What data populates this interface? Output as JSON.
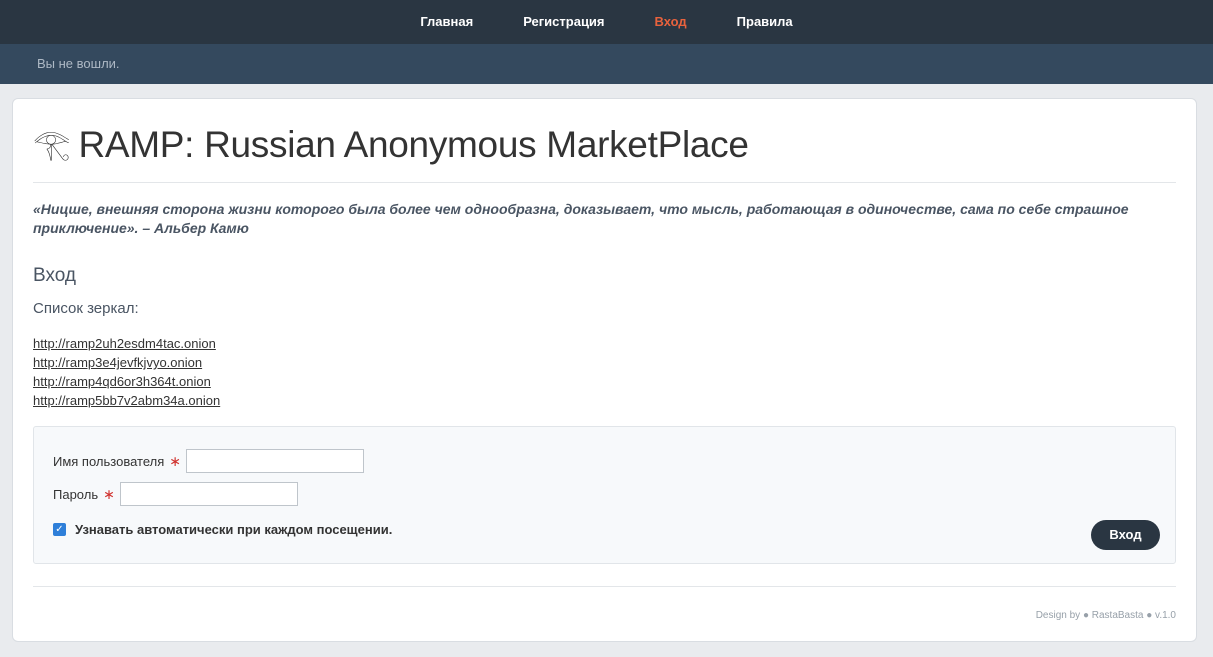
{
  "nav": {
    "items": [
      {
        "label": "Главная"
      },
      {
        "label": "Регистрация"
      },
      {
        "label": "Вход"
      },
      {
        "label": "Правила"
      }
    ]
  },
  "status": {
    "text": "Вы не вошли."
  },
  "header": {
    "title": "RAMP: Russian Anonymous MarketPlace",
    "icon": "eye-of-horus-icon"
  },
  "quote": {
    "text": "«Ницше, внешняя сторона жизни которого была более чем однообразна, доказывает, что мысль, работающая в одиночестве, сама по себе страшное приключение». – Альбер Камю"
  },
  "login": {
    "title": "Вход",
    "mirrors_label": "Список зеркал:",
    "mirrors": [
      "http://ramp2uh2esdm4tac.onion",
      "http://ramp3e4jevfkjvyo.onion",
      "http://ramp4qd6or3h364t.onion",
      "http://ramp5bb7v2abm34a.onion"
    ],
    "username_label": "Имя пользователя",
    "username_value": "",
    "password_label": "Пароль",
    "password_value": "",
    "required_mark": "∗",
    "remember_label": "Узнавать автоматически при каждом посещении.",
    "remember_checked": true,
    "submit_label": "Вход"
  },
  "footer": {
    "text": "Design by ● RastaBasta ● v.1.0"
  },
  "colors": {
    "nav_bg": "#2a3642",
    "status_bg": "#34495e",
    "active_nav": "#e8623d",
    "button_bg": "#2a3642",
    "required": "#d0312d",
    "checkbox": "#2e7fd9"
  }
}
